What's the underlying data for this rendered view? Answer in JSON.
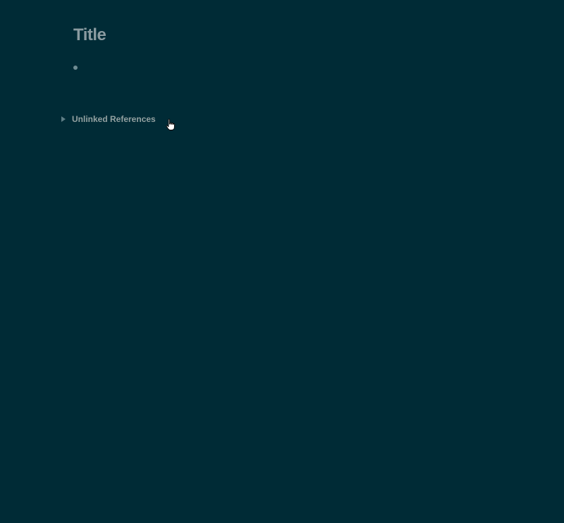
{
  "page": {
    "title": "Title",
    "blocks": [
      {
        "text": ""
      }
    ]
  },
  "references": {
    "label": "Unlinked References",
    "expanded": false,
    "toggle_icon": "caret-right-icon"
  },
  "cursor": {
    "icon": "hand-pointer-icon"
  },
  "colors": {
    "background": "#002b36",
    "title": "#8a9ba0",
    "text": "#93a1a1",
    "bullet": "#6f8c93"
  }
}
